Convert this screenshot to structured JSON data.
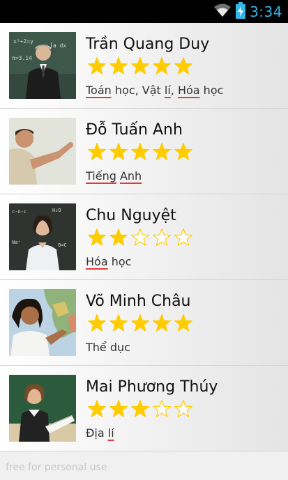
{
  "status_bar": {
    "time": "3:34",
    "icons": [
      "wifi-icon",
      "battery-charging-icon"
    ],
    "accent": "#33b5e5"
  },
  "teachers": [
    {
      "name": "Trần Quang Duy",
      "rating": 5,
      "max_rating": 5,
      "subjects": [
        {
          "text": "Toán",
          "sq": true
        },
        {
          "text": " học, ",
          "sq": false
        },
        {
          "text": "Vật",
          "sq": false
        },
        {
          "text": " ",
          "sq": false
        },
        {
          "text": "lí",
          "sq": true
        },
        {
          "text": ", ",
          "sq": false
        },
        {
          "text": "Hóa",
          "sq": true
        },
        {
          "text": " học",
          "sq": false
        }
      ]
    },
    {
      "name": "Đỗ Tuấn Anh",
      "rating": 5,
      "max_rating": 5,
      "subjects": [
        {
          "text": "Tiếng",
          "sq": true
        },
        {
          "text": " ",
          "sq": false
        },
        {
          "text": "Anh",
          "sq": true
        }
      ]
    },
    {
      "name": "Chu Nguyệt",
      "rating": 2,
      "max_rating": 5,
      "subjects": [
        {
          "text": "Hóa",
          "sq": true
        },
        {
          "text": " học",
          "sq": false
        }
      ]
    },
    {
      "name": "Võ Minh Châu",
      "rating": 5,
      "max_rating": 5,
      "subjects": [
        {
          "text": "Thể dục",
          "sq": false
        }
      ]
    },
    {
      "name": "Mai Phương Thúy",
      "rating": 3,
      "max_rating": 5,
      "subjects": [
        {
          "text": "Địa",
          "sq": false
        },
        {
          "text": " ",
          "sq": false
        },
        {
          "text": "lí",
          "sq": true
        }
      ]
    }
  ],
  "star_colors": {
    "filled": "#ffcc00",
    "empty_fill": "#ffffff",
    "empty_stroke": "#ffcc00"
  },
  "footer": {
    "text": "free for personal use"
  }
}
